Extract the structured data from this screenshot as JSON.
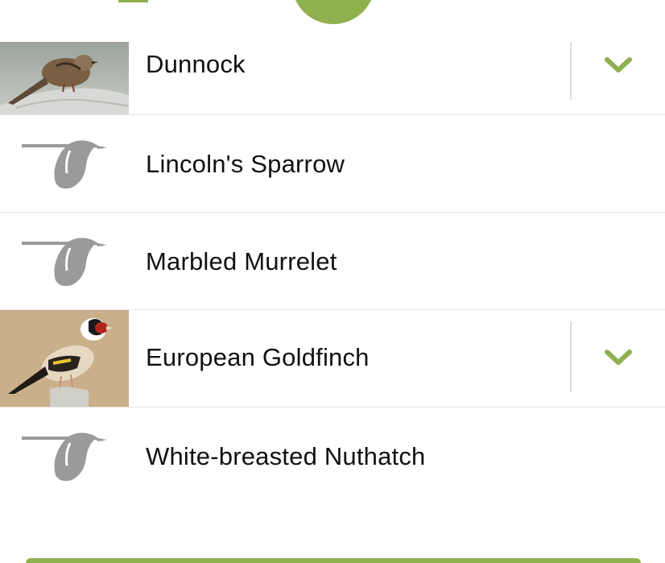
{
  "colors": {
    "accent": "#8fb04f",
    "text": "#111111",
    "divider": "#e4e4e4",
    "placeholder_icon": "#9a9a9a"
  },
  "birds": [
    {
      "name": "Dunnock",
      "image": "photo",
      "expand_icon": "chevron-down-icon"
    },
    {
      "name": "Lincoln's Sparrow",
      "image": "placeholder-bird-icon"
    },
    {
      "name": "Marbled Murrelet",
      "image": "placeholder-bird-icon"
    },
    {
      "name": "European Goldfinch",
      "image": "photo",
      "expand_icon": "chevron-down-icon"
    },
    {
      "name": "White-breasted Nuthatch",
      "image": "placeholder-bird-icon"
    }
  ]
}
